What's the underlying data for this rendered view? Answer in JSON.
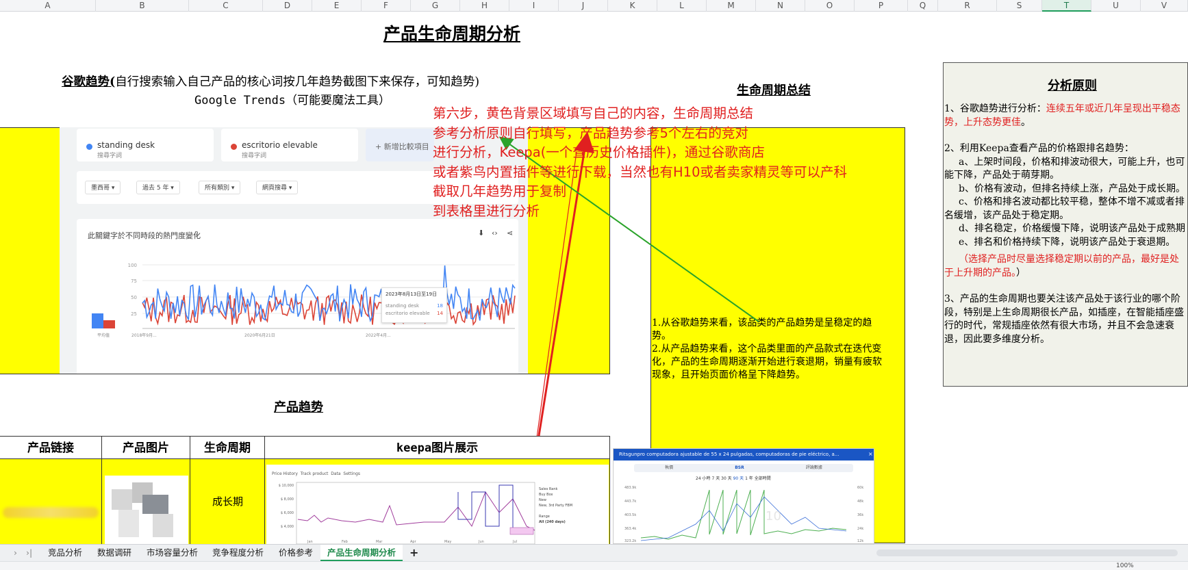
{
  "columns": [
    "A",
    "B",
    "C",
    "D",
    "E",
    "F",
    "G",
    "H",
    "I",
    "J",
    "K",
    "L",
    "M",
    "N",
    "O",
    "P",
    "Q",
    "R",
    "S",
    "T",
    "U",
    "V"
  ],
  "selected_column": "T",
  "title": "产品生命周期分析",
  "trends_section": {
    "heading_underlined": "谷歌趋势(",
    "heading_rest": "自行搜索输入自己产品的核心词按几年趋势截图下来保存，可知趋势)",
    "subheading": "Google Trends（可能要魔法工具）"
  },
  "instruction_lines": [
    "第六步，黄色背景区域填写自己的内容，生命周期总结",
    "参考分析原则自行填写，产品趋势参考5个左右的竞对",
    "进行分析，Keepa(一个查历史价格插件)，通过谷歌商店",
    "或者紫鸟内置插件等进行下载，当然也有H10或者卖家精灵等可以产科",
    "截取几年趋势用于复制",
    "到表格里进行分析"
  ],
  "trends_screenshot": {
    "term1": "standing desk",
    "term1_sub": "搜尋字詞",
    "term2": "escritorio elevable",
    "term2_sub": "搜尋字詞",
    "add_compare": "+ 新增比較項目",
    "filters": [
      "墨西哥 ▾",
      "過去 5 年 ▾",
      "所有類別 ▾",
      "網頁搜尋 ▾"
    ],
    "chart_title": "此關鍵字於不同時段的熱門度變化",
    "y_ticks": [
      "100",
      "75",
      "50",
      "25"
    ],
    "x_ticks": [
      "2018年9月...",
      "2020年6月21日",
      "2022年4月..."
    ],
    "avg_label": "平均值",
    "tooltip_date": "2023年8月13日至19日",
    "tooltip_rows": [
      {
        "label": "standing desk",
        "value": "18"
      },
      {
        "label": "escritorio elevable",
        "value": "14"
      }
    ],
    "colors": {
      "term1": "#4285f4",
      "term2": "#db4437"
    }
  },
  "summary": {
    "heading": "生命周期总结",
    "lines": [
      "1.从谷歌趋势来看，该品类的产品趋势是呈稳定的趋势。",
      "2.从产品趋势来看，这个品类里面的产品款式在迭代变化，产品的生命周期逐渐开始进行衰退期，销量有疲软现象，且开始页面价格呈下降趋势。"
    ]
  },
  "principles": {
    "heading": "分析原则",
    "p1_prefix": "1、谷歌趋势进行分析：",
    "p1_red": "连续五年或近几年呈现出平稳态势，上升态势更佳",
    "p1_suffix": "。",
    "p2": "2、利用Keepa查看产品的价格跟排名趋势：",
    "p2_items": [
      "a、上架时间段，价格和排波动很大，可能上升，也可能下降，产品处于萌芽期。",
      "b、价格有波动，但排名持续上涨，产品处于成长期。",
      "c、价格和排名波动都比较平稳，整体不增不减或者排名缓增，该产品处于稳定期。",
      "d、排名稳定，价格缓慢下降，说明该产品处于成熟期",
      "e、排名和价格持续下降，说明该产品处于衰退期。"
    ],
    "p2_note_red": "（选择产品时尽量选择稳定期以前的产品，最好是处于上升期的产品。",
    "p2_note_suffix": "）",
    "p3": "3、产品的生命周期也要关注该产品处于该行业的哪个阶段，特别是上生命周期很长产品，如插座，在智能插座盛行的时代，常规插座依然有很大市场，并且不会急速衰退，因此要多维度分析。"
  },
  "product_trend_heading": "产品趋势",
  "table": {
    "headers": [
      "产品链接",
      "产品图片",
      "生命周期",
      "keepa图片展示"
    ],
    "row1_lifecycle": "成长期"
  },
  "keepa1": {
    "tabs": [
      "Price History",
      "Track product",
      "Data",
      "Settings"
    ],
    "y_ticks": [
      "$ 10,000",
      "$ 8,000",
      "$ 6,000",
      "$ 4,000"
    ],
    "legend": [
      "Sales Rank",
      "Buy Box",
      "New",
      "New, 3rd Party FBM"
    ],
    "range_label": "Range",
    "range_value": "All (240 days)",
    "months": [
      "Jan",
      "Feb",
      "Mar",
      "Apr",
      "May",
      "Jun",
      "Jul"
    ]
  },
  "keepa2": {
    "header": "Ritsgunpro computadora ajustable de 55 x 24 pulgadas, computadoras de pie eléctrico, a...",
    "tabs": [
      "執價",
      "BSR",
      "評論數據"
    ],
    "ranges": [
      "24 小時",
      "7 天",
      "30 天",
      "90 天",
      "1 年",
      "全部時間"
    ],
    "y_left": [
      "483.9k",
      "443.7k",
      "403.5k",
      "363.4k",
      "323.2k"
    ],
    "y_right": [
      "60k",
      "48k",
      "36k",
      "24k",
      "12k"
    ],
    "watermark": "10"
  },
  "sheet_tabs": [
    "竞品分析",
    "数据调研",
    "市场容量分析",
    "竞争程度分析",
    "价格参考",
    "产品生命周期分析"
  ],
  "active_tab": "产品生命周期分析",
  "add_tab": "+",
  "zoom": "100%"
}
